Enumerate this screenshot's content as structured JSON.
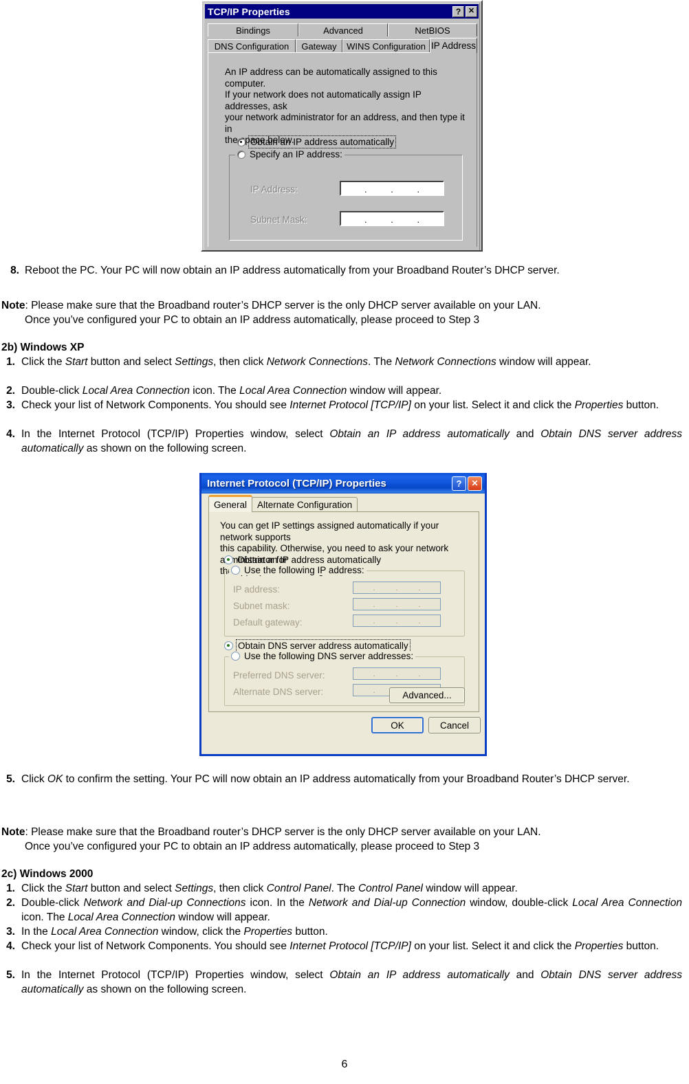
{
  "page": {
    "number": "6"
  },
  "dialog_win9x": {
    "title": "TCP/IP Properties",
    "titlebar_color": "#000080",
    "help_button": "?",
    "close_button": "✕",
    "tabs_row1": [
      "Bindings",
      "Advanced",
      "NetBIOS"
    ],
    "tabs_row2": [
      "DNS Configuration",
      "Gateway",
      "WINS Configuration",
      "IP Address"
    ],
    "active_tab": "IP Address",
    "description": "An IP address can be automatically assigned to this computer.\nIf your network does not automatically assign IP addresses, ask\nyour network administrator for an address, and then type it in\nthe space below.",
    "radio_auto_label": "Obtain an IP address automatically",
    "radio_auto_selected": true,
    "radio_specify_label": "Specify an IP address:",
    "radio_specify_selected": false,
    "field_ip_label": "IP Address:",
    "field_ip_value": "",
    "field_subnet_label": "Subnet Mask:",
    "field_subnet_value": "",
    "ip_separator": "."
  },
  "dialog_winxp": {
    "title": "Internet Protocol (TCP/IP) Properties",
    "help_button": "?",
    "close_button": "✕",
    "tabs": [
      "General",
      "Alternate Configuration"
    ],
    "active_tab": "General",
    "description": "You can get IP settings assigned automatically if your network supports\nthis capability. Otherwise, you need to ask your network administrator for\nthe appropriate IP settings.",
    "radio_ip_auto_label": "Obtain an IP address automatically",
    "radio_ip_auto_selected": true,
    "radio_ip_manual_label": "Use the following IP address:",
    "radio_ip_manual_selected": false,
    "field_ip_label": "IP address:",
    "field_ip_value": "",
    "field_subnet_label": "Subnet mask:",
    "field_subnet_value": "",
    "field_gateway_label": "Default gateway:",
    "field_gateway_value": "",
    "radio_dns_auto_label": "Obtain DNS server address automatically",
    "radio_dns_auto_selected": true,
    "radio_dns_manual_label": "Use the following DNS server addresses:",
    "radio_dns_manual_selected": false,
    "field_pref_dns_label": "Preferred DNS server:",
    "field_pref_dns_value": "",
    "field_alt_dns_label": "Alternate DNS server:",
    "field_alt_dns_value": "",
    "button_advanced": "Advanced...",
    "button_ok": "OK",
    "button_cancel": "Cancel",
    "ip_separator": "."
  },
  "content": {
    "step8": {
      "number": "8.",
      "text": "Reboot the PC. Your PC will now obtain an IP address automatically from your Broadband Router’s DHCP server."
    },
    "note1": {
      "label": "Note",
      "line1": ": Please make sure that the Broadband router’s DHCP server is the   only DHCP server available on your LAN.",
      "line2": "Once you’ve configured your PC to obtain an IP address automatically, please proceed to Step 3"
    },
    "section_xp": {
      "heading": "2b) Windows XP",
      "items": [
        {
          "number": "1.",
          "parts": [
            {
              "t": "Click the ",
              "s": "n"
            },
            {
              "t": "Start",
              "s": "i"
            },
            {
              "t": " button and select ",
              "s": "n"
            },
            {
              "t": "Settings",
              "s": "i"
            },
            {
              "t": ", then click ",
              "s": "n"
            },
            {
              "t": "Network Connections",
              "s": "i"
            },
            {
              "t": ". The ",
              "s": "n"
            },
            {
              "t": "Network Connections",
              "s": "i"
            },
            {
              "t": " window will appear.",
              "s": "n"
            }
          ]
        },
        {
          "number": "2.",
          "parts": [
            {
              "t": "Double-click ",
              "s": "n"
            },
            {
              "t": "Local Area Connection",
              "s": "i"
            },
            {
              "t": " icon. The ",
              "s": "n"
            },
            {
              "t": "Local Area Connection",
              "s": "i"
            },
            {
              "t": " window will appear.",
              "s": "n"
            }
          ]
        },
        {
          "number": "3.",
          "parts": [
            {
              "t": "Check your list of Network Components. You should see ",
              "s": "n"
            },
            {
              "t": "Internet Protocol [TCP/IP]",
              "s": "i"
            },
            {
              "t": " on your list. Select it and click the ",
              "s": "n"
            },
            {
              "t": "Properties",
              "s": "i"
            },
            {
              "t": " button.",
              "s": "n"
            }
          ]
        },
        {
          "number": "4.",
          "parts": [
            {
              "t": "In the Internet Protocol (TCP/IP) Properties window, select ",
              "s": "n"
            },
            {
              "t": "Obtain an IP address automatically",
              "s": "i"
            },
            {
              "t": " and ",
              "s": "n"
            },
            {
              "t": "Obtain DNS server address automatically",
              "s": "i"
            },
            {
              "t": " as shown on the following screen.",
              "s": "n"
            }
          ]
        }
      ]
    },
    "step5_xp": {
      "number": "5.",
      "parts": [
        {
          "t": "Click ",
          "s": "n"
        },
        {
          "t": "OK",
          "s": "i"
        },
        {
          "t": " to confirm the setting. Your PC will now obtain an IP address automatically from your Broadband Router’s DHCP server.",
          "s": "n"
        }
      ]
    },
    "note2": {
      "label": "Note",
      "line1": ": Please make sure that the Broadband router’s DHCP server is the   only DHCP server available on your LAN.",
      "line2": "Once you’ve configured your PC to obtain an IP address automatically, please proceed to Step 3"
    },
    "section_2000": {
      "heading": "2c) Windows 2000",
      "items": [
        {
          "number": "1.",
          "parts": [
            {
              "t": "Click the ",
              "s": "n"
            },
            {
              "t": "Start",
              "s": "i"
            },
            {
              "t": " button and select ",
              "s": "n"
            },
            {
              "t": "Settings",
              "s": "i"
            },
            {
              "t": ", then click ",
              "s": "n"
            },
            {
              "t": "Control Panel",
              "s": "i"
            },
            {
              "t": ". The ",
              "s": "n"
            },
            {
              "t": "Control Panel",
              "s": "i"
            },
            {
              "t": " window will appear.",
              "s": "n"
            }
          ]
        },
        {
          "number": "2.",
          "parts": [
            {
              "t": "Double-click ",
              "s": "n"
            },
            {
              "t": "Network and Dial-up Connections",
              "s": "i"
            },
            {
              "t": " icon. In the ",
              "s": "n"
            },
            {
              "t": "Network and Dial-up Connection",
              "s": "i"
            },
            {
              "t": " window, double-click ",
              "s": "n"
            },
            {
              "t": "Local Area Connection",
              "s": "i"
            },
            {
              "t": " icon. The ",
              "s": "n"
            },
            {
              "t": "Local Area Connection",
              "s": "i"
            },
            {
              "t": " window will appear.",
              "s": "n"
            }
          ]
        },
        {
          "number": "3.",
          "parts": [
            {
              "t": "In the ",
              "s": "n"
            },
            {
              "t": "Local Area Connection",
              "s": "i"
            },
            {
              "t": " window, click the ",
              "s": "n"
            },
            {
              "t": "Properties",
              "s": "i"
            },
            {
              "t": " button.",
              "s": "n"
            }
          ]
        },
        {
          "number": "4.",
          "parts": [
            {
              "t": "Check your list of Network Components. You should see ",
              "s": "n"
            },
            {
              "t": "Internet Protocol [TCP/IP]",
              "s": "i"
            },
            {
              "t": " on your list. Select it and click the ",
              "s": "n"
            },
            {
              "t": "Properties",
              "s": "i"
            },
            {
              "t": " button.",
              "s": "n"
            }
          ]
        },
        {
          "number": "5.",
          "parts": [
            {
              "t": "In the Internet Protocol (TCP/IP) Properties window, select ",
              "s": "n"
            },
            {
              "t": "Obtain an IP address automatically",
              "s": "i"
            },
            {
              "t": " and ",
              "s": "n"
            },
            {
              "t": "Obtain DNS server address automatically",
              "s": "i"
            },
            {
              "t": " as shown on the following screen.",
              "s": "n"
            }
          ]
        }
      ]
    }
  }
}
